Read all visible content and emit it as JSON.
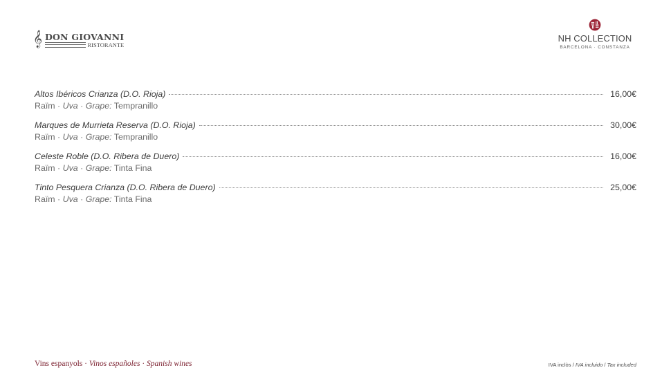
{
  "logo_left": {
    "clef_glyph": "𝄞",
    "name": "DON GIOVANNI",
    "sub": "RISTORANTE"
  },
  "logo_right": {
    "name": "NH COLLECTION",
    "sub": "BARCELONA · CONSTANZA",
    "emblem_color": "#9b2335"
  },
  "wines": [
    {
      "name": "Altos Ibéricos Crianza (D.O. Rioja)",
      "price": "16,00€",
      "grape_label_ca": "Raïm",
      "grape_label_es": "Uva",
      "grape_label_en": "Grape:",
      "grape": "Tempranillo"
    },
    {
      "name": "Marques de Murrieta Reserva (D.O. Rioja)",
      "price": "30,00€",
      "grape_label_ca": "Raïm",
      "grape_label_es": "Uva",
      "grape_label_en": "Grape:",
      "grape": "Tempranillo"
    },
    {
      "name": "Celeste Roble (D.O. Ribera de Duero)",
      "price": "16,00€",
      "grape_label_ca": "Raïm",
      "grape_label_es": "Uva",
      "grape_label_en": "Grape:",
      "grape": "Tinta Fina"
    },
    {
      "name": "Tinto Pesquera Crianza (D.O. Ribera de Duero)",
      "price": "25,00€",
      "grape_label_ca": "Raïm",
      "grape_label_es": "Uva",
      "grape_label_en": "Grape:",
      "grape": "Tinta Fina"
    }
  ],
  "footer": {
    "section_ca": "Vins espanyols",
    "section_es": "Vinos españoles",
    "section_en": "Spanish wines",
    "tax_ca": "IVA inclòs",
    "tax_es": "IVA incluido",
    "tax_en": "Tax included",
    "accent_color": "#7a1f2e"
  }
}
